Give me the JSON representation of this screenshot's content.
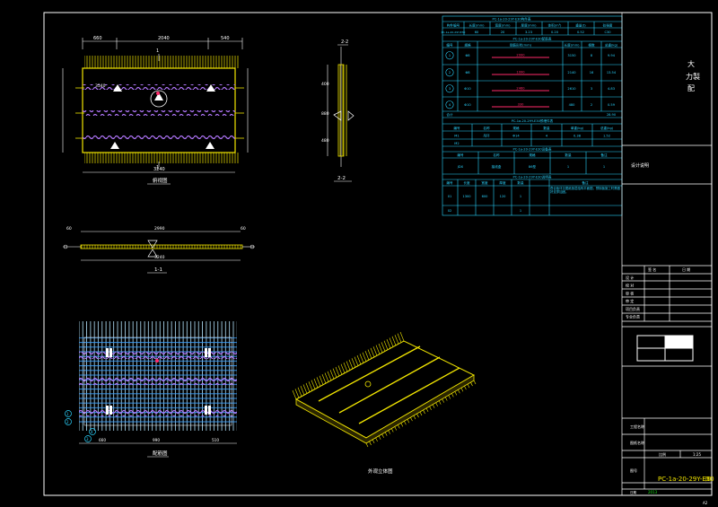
{
  "drawing": {
    "drawing_number": "PC-1a-20-29Y-E30",
    "drawing_suffix": "图",
    "stamp_lines": [
      "大",
      "力製",
      "配"
    ],
    "note_row": "设计说明",
    "bottom_right_code": "A2"
  },
  "views": {
    "plan_top": {
      "dim_left": "660",
      "dim_mid": "2040",
      "dim_right": "540",
      "dim_total": "3240",
      "section_mark": "1",
      "caption": "俯视图",
      "bar_label": "3540"
    },
    "section_22": {
      "caption": "2-2",
      "dims": [
        "400",
        "880",
        "480"
      ]
    },
    "section_11": {
      "caption": "1-1",
      "dim_top": "2990",
      "dim_bottom": "3240",
      "dim_left": "60",
      "dim_right": "60"
    },
    "rebar_plan": {
      "caption": "配筋图",
      "dim_a": "660",
      "dim_b": "990",
      "dim_c": "510",
      "bubbles": [
        "1",
        "2",
        "3",
        "4"
      ]
    },
    "iso": {
      "caption": "外观立体图"
    }
  },
  "tables": {
    "t1": {
      "title": "PC-1a-20-29Y-E30构件表",
      "headers": [
        "构件编号",
        "长度(mm)",
        "宽度(mm)",
        "厚度(mm)",
        "体积(m³)",
        "重量(t)",
        "砼强度"
      ],
      "row": [
        "PC-1a-20-29Y-E30",
        "60",
        "20",
        "3.23",
        "0.20",
        "0.52",
        "C30"
      ]
    },
    "t2": {
      "title": "PC-1a-20-29Y-E30配筋表",
      "headers": [
        "编号",
        "规格",
        "钢筋形状(mm)",
        "长度(mm)",
        "根数",
        "总重(kg)"
      ],
      "rows": [
        {
          "id": "1",
          "spec": "Φ8",
          "shape": "2990",
          "len": "3150",
          "qty": "8",
          "kg": "9.94"
        },
        {
          "id": "2",
          "spec": "Φ8",
          "shape": "1990",
          "len": "2140",
          "qty": "16",
          "kg": "13.54"
        },
        {
          "id": "3",
          "spec": "Φ10",
          "shape": "2460",
          "len": "2610",
          "qty": "3",
          "kg": "4.83"
        },
        {
          "id": "4",
          "spec": "Φ10",
          "shape": "330",
          "len": "480",
          "qty": "2",
          "kg": "0.59"
        }
      ],
      "total_label": "合计",
      "total": "28.90"
    },
    "t3": {
      "title": "PC-1a-20-29Y-E30预埋件表",
      "headers": [
        "编号",
        "名称",
        "规格",
        "数量",
        "单重(kg)",
        "总重(kg)"
      ],
      "rows": [
        [
          "M1",
          "吊环",
          "Φ14",
          "4",
          "0.38",
          "1.52"
        ],
        [
          "M2",
          "",
          "",
          "",
          "",
          ""
        ]
      ]
    },
    "t4": {
      "title": "PC-1a-20-29Y-E30设备表",
      "headers": [
        "编号",
        "名称",
        "规格",
        "数量",
        "备注"
      ],
      "row": [
        "JDX",
        "接线盒",
        "86型",
        "1",
        "1"
      ]
    },
    "t5": {
      "title": "PC-1a-20-29Y-E30说明表",
      "headers": [
        "编号",
        "长度",
        "宽度",
        "厚度",
        "数量",
        "备注"
      ],
      "rows": [
        [
          "01",
          "1300",
          "600",
          "120",
          "1",
          "叠合板详见图纸各层结构平面图，预制板施工时需做好支撑加固。"
        ],
        [
          "02",
          "",
          "",
          "",
          "1",
          ""
        ]
      ]
    }
  },
  "title_block": {
    "sign_headers": [
      "签 名",
      "日 期"
    ],
    "rows": [
      "设 计",
      "校 对",
      "审 核",
      "审 定",
      "项目负责",
      "专业负责"
    ],
    "label_project": "工程名称",
    "label_sheet": "图纸名称",
    "label_scale": "比例",
    "scale": "1:25",
    "label_no": "图号",
    "label_date": "日期",
    "date": "2013"
  }
}
